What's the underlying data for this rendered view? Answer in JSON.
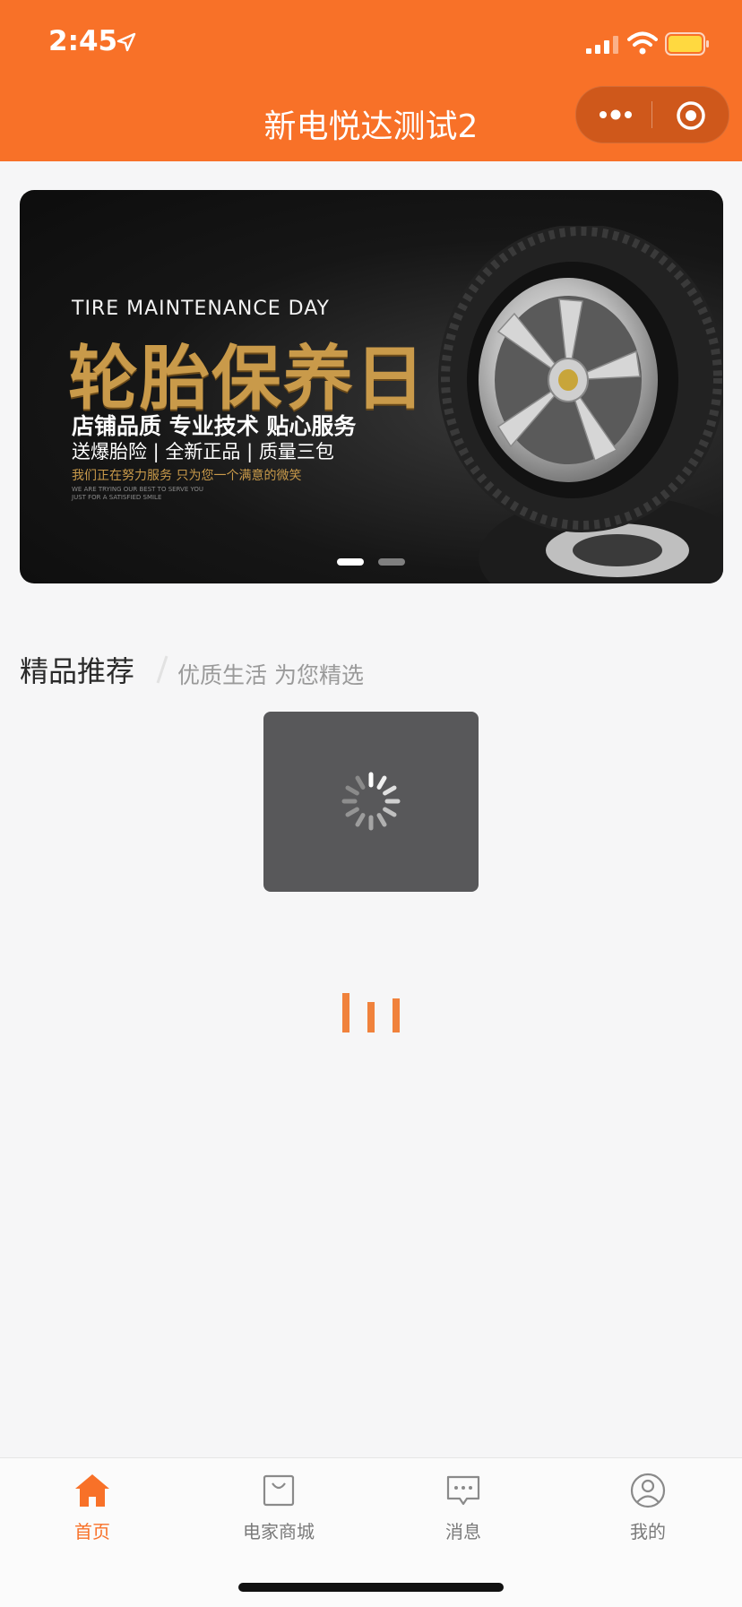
{
  "status_bar": {
    "time": "2:45"
  },
  "nav": {
    "title": "新电悦达测试2"
  },
  "banner": {
    "en_title": "TIRE MAINTENANCE DAY",
    "cn_title": "轮胎保养日",
    "line1": "店铺品质 专业技术 贴心服务",
    "line2": "送爆胎险 | 全新正品 | 质量三包",
    "line3": "我们正在努力服务 只为您一个满意的微笑",
    "line4": "WE ARE TRYING OUR BEST TO SERVE YOU JUST FOR A SATISFIED SMILE",
    "slides_total": 2,
    "active_slide": 1
  },
  "section": {
    "title": "精品推荐",
    "subtitle": "优质生活 为您精选"
  },
  "tabbar": {
    "items": [
      {
        "label": "首页",
        "icon": "home-icon",
        "active": true
      },
      {
        "label": "电家商城",
        "icon": "shopping-bag-icon",
        "active": false
      },
      {
        "label": "消息",
        "icon": "message-icon",
        "active": false
      },
      {
        "label": "我的",
        "icon": "profile-icon",
        "active": false
      }
    ]
  },
  "colors": {
    "accent": "#f87128",
    "background": "#f6f6f7",
    "toast": "#58585a"
  }
}
